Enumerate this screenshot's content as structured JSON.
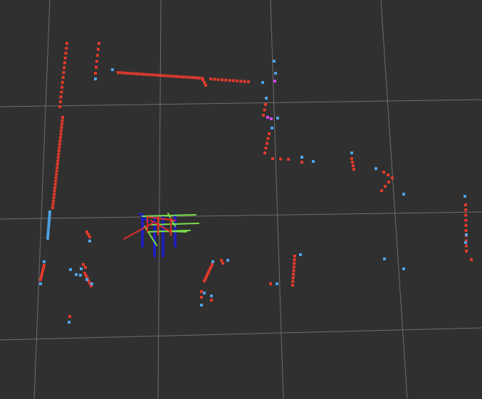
{
  "view": {
    "background_color": "#303030",
    "grid_color": "#a0a0a0",
    "colors": {
      "scan_point": "#e23a2b",
      "alt_point": "#4ea3e6",
      "highlight_point": "#d946ef",
      "axis_x": "#e22b2b",
      "axis_y": "#79e04a",
      "axis_z": "#1f1fb8"
    }
  }
}
